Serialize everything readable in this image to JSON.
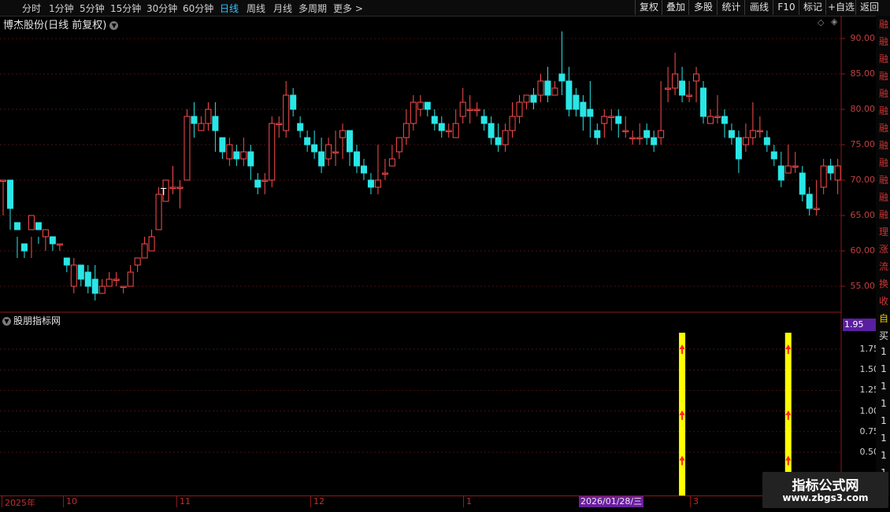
{
  "toolbar": {
    "periods": [
      "分时",
      "1分钟",
      "5分钟",
      "15分钟",
      "30分钟",
      "60分钟",
      "日线",
      "周线",
      "月线",
      "多周期",
      "更多 >"
    ],
    "active_period": "日线",
    "buttons": [
      "复权",
      "叠加",
      "多股",
      "统计",
      "画线",
      "F10",
      "标记",
      "+自选",
      "返回"
    ]
  },
  "chart_header": {
    "title": "博杰股份(日线 前复权)"
  },
  "indicator_header": {
    "title": "股朋指标网",
    "last_value": "1.95"
  },
  "price_axis": [
    "90.00",
    "85.00",
    "80.00",
    "75.00",
    "70.00",
    "65.00",
    "60.00",
    "55.00"
  ],
  "indicator_axis": [
    "1.75",
    "1.50",
    "1.25",
    "1.00",
    "0.75",
    "0.50"
  ],
  "x_axis": {
    "labels": [
      "2025年",
      "10",
      "11",
      "12",
      "1",
      "3"
    ],
    "highlight_date": "2026/01/28/三"
  },
  "annotation_marker": "T",
  "right_strip_chars": [
    "融",
    "融",
    "融",
    "融",
    "融",
    "融",
    "融",
    "融",
    "融",
    "融",
    "融",
    "融",
    "理",
    "涨",
    "流",
    "换",
    "收",
    "自",
    "买",
    "1",
    "1",
    "1",
    "1",
    "1",
    "1",
    "1",
    "1"
  ],
  "watermark": {
    "title": "指标公式网",
    "url": "www.zbgs3.com"
  },
  "colors": {
    "up": "#ff4d4d",
    "down": "#29e6e6",
    "signal": "#ffff00",
    "arrow": "#ff2020",
    "grid": "#4a1010"
  },
  "chart_data": {
    "type": "candlestick",
    "ylim": [
      51,
      92
    ],
    "candles": [
      [
        70,
        70,
        65,
        70
      ],
      [
        70,
        66,
        63,
        66
      ],
      [
        64,
        63,
        59,
        62
      ],
      [
        61,
        60,
        59,
        60
      ],
      [
        63,
        65,
        59,
        62
      ],
      [
        64,
        63,
        62,
        61
      ],
      [
        62,
        63,
        60,
        63
      ],
      [
        62,
        61,
        60,
        62
      ],
      [
        61,
        61,
        60,
        61
      ],
      [
        59,
        58,
        57,
        58
      ],
      [
        55,
        58,
        54,
        59
      ],
      [
        58,
        56,
        55,
        58
      ],
      [
        57,
        55,
        54,
        58
      ],
      [
        56,
        54,
        53,
        58
      ],
      [
        54,
        55,
        54,
        56
      ],
      [
        55,
        56,
        55,
        57
      ],
      [
        56,
        56,
        55,
        57
      ],
      [
        55,
        55,
        54,
        55
      ],
      [
        55,
        57,
        55,
        58
      ],
      [
        58,
        59,
        57,
        59
      ],
      [
        59,
        61,
        59,
        62
      ],
      [
        60,
        62,
        60,
        63
      ],
      [
        63,
        68,
        63,
        69
      ],
      [
        67,
        70,
        67,
        70
      ],
      [
        69,
        69,
        68,
        72
      ],
      [
        69,
        69,
        66,
        70
      ],
      [
        70,
        79,
        70,
        80
      ],
      [
        79,
        78,
        76,
        81
      ],
      [
        77,
        78,
        77,
        79
      ],
      [
        78,
        80,
        77,
        81
      ],
      [
        79,
        77,
        74,
        81
      ],
      [
        76,
        74,
        73,
        76
      ],
      [
        73,
        75,
        72,
        76
      ],
      [
        74,
        73,
        72,
        75
      ],
      [
        73,
        74,
        72,
        76
      ],
      [
        74,
        72,
        70,
        75
      ],
      [
        70,
        69,
        68,
        71
      ],
      [
        70,
        70,
        68,
        71
      ],
      [
        70,
        78,
        69,
        79
      ],
      [
        78,
        78,
        76,
        79
      ],
      [
        77,
        82,
        76,
        84
      ],
      [
        82,
        80,
        79,
        83
      ],
      [
        78,
        77,
        76,
        79
      ],
      [
        76,
        75,
        74,
        77
      ],
      [
        75,
        74,
        73,
        77
      ],
      [
        74,
        72,
        71,
        76
      ],
      [
        73,
        75,
        72,
        76
      ],
      [
        74,
        74,
        72,
        77
      ],
      [
        76,
        77,
        73,
        78
      ],
      [
        77,
        74,
        72,
        77
      ],
      [
        74,
        72,
        71,
        75
      ],
      [
        72,
        71,
        70,
        73
      ],
      [
        70,
        69,
        68,
        71
      ],
      [
        69,
        70,
        68,
        75
      ],
      [
        71,
        71,
        70,
        73
      ],
      [
        72,
        73,
        72,
        75
      ],
      [
        74,
        76,
        73,
        76
      ],
      [
        76,
        78,
        75,
        80
      ],
      [
        78,
        81,
        77,
        82
      ],
      [
        80,
        81,
        79,
        82
      ],
      [
        81,
        80,
        79,
        81
      ],
      [
        79,
        78,
        77,
        80
      ],
      [
        78,
        77,
        76,
        79
      ],
      [
        77,
        77,
        76,
        78
      ],
      [
        76,
        78,
        76,
        80
      ],
      [
        79,
        81,
        78,
        83
      ],
      [
        80,
        80,
        78,
        82
      ],
      [
        80,
        80,
        79,
        81
      ],
      [
        79,
        78,
        77,
        80
      ],
      [
        78,
        76,
        75,
        79
      ],
      [
        76,
        75,
        74,
        78
      ],
      [
        75,
        77,
        74,
        78
      ],
      [
        77,
        79,
        76,
        81
      ],
      [
        79,
        81,
        78,
        82
      ],
      [
        81,
        82,
        80,
        82
      ],
      [
        82,
        81,
        80,
        83
      ],
      [
        82,
        84,
        81,
        85
      ],
      [
        84,
        82,
        81,
        86
      ],
      [
        82,
        83,
        82,
        84
      ],
      [
        85,
        84,
        82,
        91
      ],
      [
        84,
        80,
        79,
        86
      ],
      [
        82,
        80,
        79,
        83
      ],
      [
        81,
        79,
        77,
        82
      ],
      [
        80,
        79,
        76,
        84
      ],
      [
        77,
        76,
        75,
        78
      ],
      [
        78,
        79,
        76,
        80
      ],
      [
        79,
        79,
        77,
        80
      ],
      [
        79,
        78,
        76,
        80
      ],
      [
        77,
        77,
        76,
        79
      ],
      [
        76,
        76,
        75,
        77
      ],
      [
        76,
        76,
        75,
        78
      ],
      [
        77,
        76,
        75,
        78
      ],
      [
        76,
        75,
        74,
        77
      ],
      [
        76,
        77,
        75,
        84
      ],
      [
        83,
        83,
        81,
        86
      ],
      [
        83,
        85,
        82,
        88
      ],
      [
        84,
        82,
        81,
        86
      ],
      [
        82,
        82,
        81,
        84
      ],
      [
        84,
        85,
        81,
        86
      ],
      [
        83,
        79,
        78,
        84
      ],
      [
        78,
        79,
        78,
        80
      ],
      [
        79,
        79,
        78,
        82
      ],
      [
        79,
        78,
        76,
        80
      ],
      [
        77,
        76,
        75,
        78
      ],
      [
        76,
        73,
        71,
        77
      ],
      [
        75,
        76,
        74,
        78
      ],
      [
        76,
        77,
        75,
        81
      ],
      [
        77,
        77,
        76,
        79
      ],
      [
        76,
        75,
        74,
        77
      ],
      [
        74,
        73,
        72,
        75
      ],
      [
        72,
        70,
        69,
        74
      ],
      [
        71,
        72,
        71,
        75
      ],
      [
        72,
        72,
        71,
        74
      ],
      [
        71,
        68,
        67,
        72
      ],
      [
        68,
        66,
        65,
        69
      ],
      [
        66,
        66,
        65,
        70
      ],
      [
        69,
        72,
        68,
        73
      ],
      [
        72,
        71,
        70,
        73
      ],
      [
        70,
        72,
        68,
        73
      ]
    ],
    "signals": [
      {
        "index": 96,
        "value": 1.95,
        "arrows": [
          1.75,
          0.95,
          0.4
        ]
      },
      {
        "index": 111,
        "value": 1.95,
        "arrows": [
          1.75,
          0.95,
          0.4
        ]
      }
    ]
  }
}
